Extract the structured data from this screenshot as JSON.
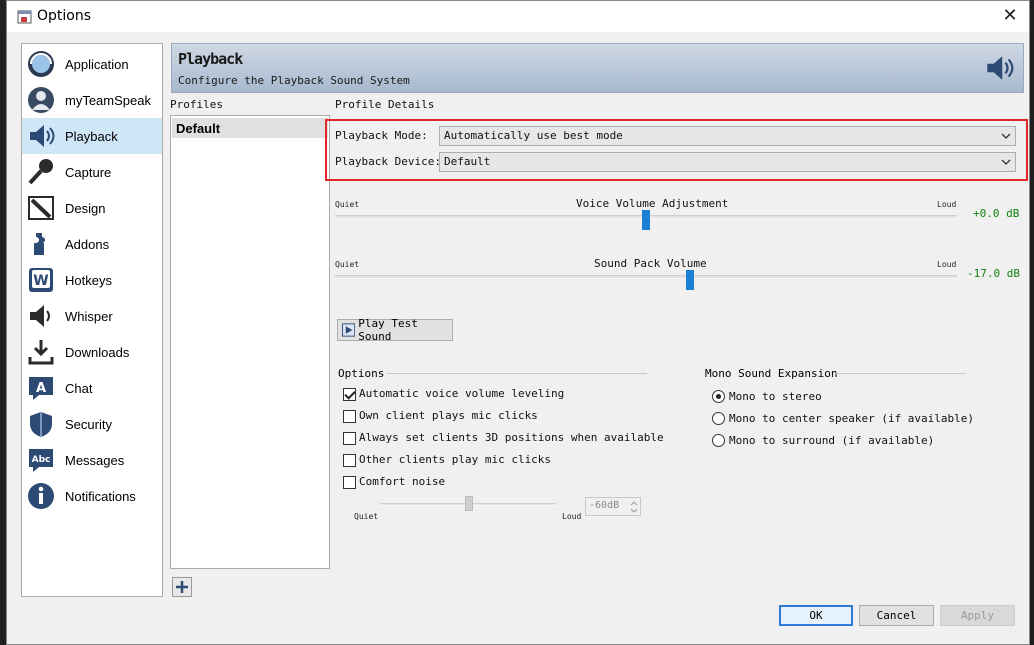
{
  "window": {
    "title": "Options"
  },
  "sidebar": {
    "items": [
      {
        "label": "Application",
        "icon": "application-icon"
      },
      {
        "label": "myTeamSpeak",
        "icon": "user-icon"
      },
      {
        "label": "Playback",
        "icon": "speaker-icon",
        "active": true
      },
      {
        "label": "Capture",
        "icon": "microphone-icon"
      },
      {
        "label": "Design",
        "icon": "design-icon"
      },
      {
        "label": "Addons",
        "icon": "puzzle-icon"
      },
      {
        "label": "Hotkeys",
        "icon": "hotkey-icon"
      },
      {
        "label": "Whisper",
        "icon": "whisper-icon"
      },
      {
        "label": "Downloads",
        "icon": "download-icon"
      },
      {
        "label": "Chat",
        "icon": "chat-icon"
      },
      {
        "label": "Security",
        "icon": "shield-icon"
      },
      {
        "label": "Messages",
        "icon": "messages-icon"
      },
      {
        "label": "Notifications",
        "icon": "info-icon"
      }
    ]
  },
  "header": {
    "title": "Playback",
    "subtitle": "Configure the Playback Sound System"
  },
  "profiles": {
    "label": "Profiles",
    "items": [
      "Default"
    ]
  },
  "details": {
    "label": "Profile Details",
    "playback_mode": {
      "label": "Playback Mode:",
      "value": "Automatically use best mode"
    },
    "playback_device": {
      "label": "Playback Device:",
      "value": "Default"
    }
  },
  "voice_volume": {
    "title": "Voice Volume Adjustment",
    "min_label": "Quiet",
    "max_label": "Loud",
    "value_text": "+0.0 dB",
    "position": 0.5
  },
  "sound_pack": {
    "title": "Sound Pack Volume",
    "min_label": "Quiet",
    "max_label": "Loud",
    "value_text": "-17.0 dB",
    "position": 0.57
  },
  "play_test_sound": "Play Test Sound",
  "options": {
    "title": "Options",
    "items": [
      {
        "label": "Automatic voice volume leveling",
        "checked": true
      },
      {
        "label": "Own client plays mic clicks",
        "checked": false
      },
      {
        "label": "Always set clients 3D positions when available",
        "checked": false
      },
      {
        "label": "Other clients play mic clicks",
        "checked": false
      },
      {
        "label": "Comfort noise",
        "checked": false
      }
    ],
    "comfort_slider": {
      "min_label": "Quiet",
      "max_label": "Loud",
      "value_text": "-60dB"
    }
  },
  "mono": {
    "title": "Mono Sound Expansion",
    "items": [
      {
        "label": "Mono to stereo",
        "checked": true
      },
      {
        "label": "Mono to center speaker (if available)",
        "checked": false
      },
      {
        "label": "Mono to surround (if available)",
        "checked": false
      }
    ]
  },
  "buttons": {
    "ok": "OK",
    "cancel": "Cancel",
    "apply": "Apply"
  },
  "colors": {
    "accent": "#1e7fd8",
    "highlight_border": "#e0262a",
    "db_text": "#128212"
  }
}
